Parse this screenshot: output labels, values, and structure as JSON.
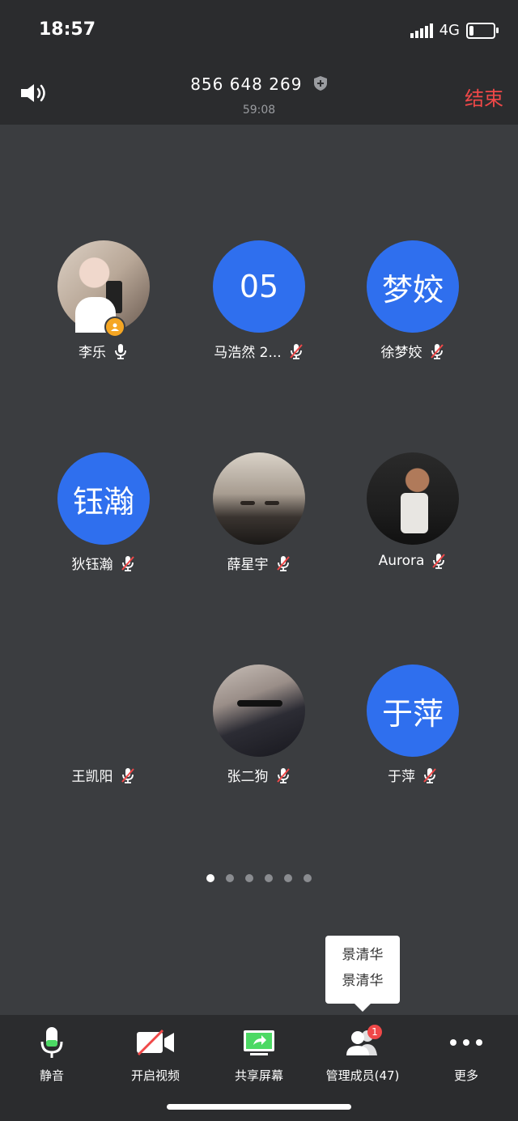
{
  "status_bar": {
    "time": "18:57",
    "network": "4G"
  },
  "header": {
    "meeting_id": "856 648 269",
    "elapsed": "59:08",
    "end_label": "结束"
  },
  "participants": [
    {
      "name": "李乐",
      "avatar_type": "photo",
      "avatar_text": "",
      "mic": "on",
      "host": true
    },
    {
      "name": "马浩然 2...",
      "avatar_type": "text",
      "avatar_text": "05",
      "mic": "muted",
      "host": false
    },
    {
      "name": "徐梦姣",
      "avatar_type": "text",
      "avatar_text": "梦姣",
      "mic": "muted",
      "host": false
    },
    {
      "name": "狄钰瀚",
      "avatar_type": "text",
      "avatar_text": "钰瀚",
      "mic": "muted",
      "host": false
    },
    {
      "name": "薛星宇",
      "avatar_type": "photo",
      "avatar_text": "",
      "mic": "muted",
      "host": false
    },
    {
      "name": "Aurora",
      "avatar_type": "photo",
      "avatar_text": "",
      "mic": "muted",
      "host": false
    },
    {
      "name": "王凯阳",
      "avatar_type": "none",
      "avatar_text": "",
      "mic": "muted",
      "host": false
    },
    {
      "name": "张二狗",
      "avatar_type": "photo",
      "avatar_text": "",
      "mic": "muted",
      "host": false
    },
    {
      "name": "于萍",
      "avatar_type": "text",
      "avatar_text": "于萍",
      "mic": "muted",
      "host": false
    }
  ],
  "pagination": {
    "total_pages": 6,
    "current_page": 1
  },
  "tooltip": {
    "line1": "景清华",
    "line2": "景清华"
  },
  "toolbar": {
    "mute_label": "静音",
    "video_label": "开启视频",
    "share_label": "共享屏幕",
    "members_label": "管理成员(47)",
    "members_badge": "1",
    "more_label": "更多"
  },
  "colors": {
    "accent_blue": "#2f6fee",
    "end_red": "#f04848",
    "share_green": "#4cd964",
    "muted_red": "#f04848"
  }
}
